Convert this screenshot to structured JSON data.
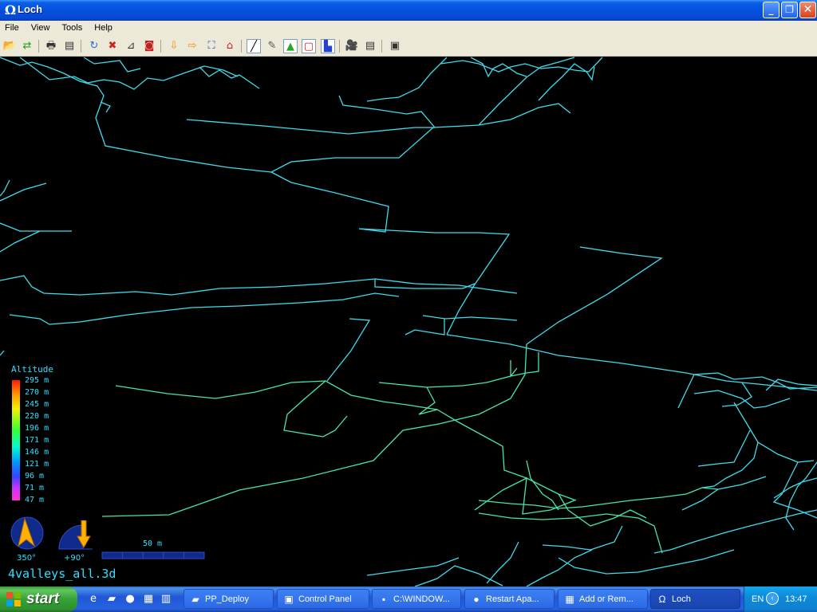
{
  "window": {
    "title": "Loch",
    "app_icon": "omega-icon",
    "controls": {
      "minimize": "_",
      "maximize": "❐",
      "close": "✕"
    }
  },
  "menu": {
    "items": [
      "File",
      "View",
      "Tools",
      "Help"
    ]
  },
  "toolbar": {
    "buttons": [
      {
        "icon": "open-folder-icon",
        "glyph": "📂",
        "color": "#d9a520"
      },
      {
        "icon": "reload-icon",
        "glyph": "⇄",
        "color": "#22a022"
      },
      {
        "icon": "print-icon",
        "glyph": "🖶",
        "color": "#333333"
      },
      {
        "icon": "export-icon",
        "glyph": "▤",
        "color": "#333333"
      },
      {
        "icon": "rotate-icon",
        "glyph": "↻",
        "color": "#2a6fe0"
      },
      {
        "icon": "rotation-off-icon",
        "glyph": "✖",
        "color": "#cc2222"
      },
      {
        "icon": "camera-angle-icon",
        "glyph": "⊿",
        "color": "#333333"
      },
      {
        "icon": "stereo-glasses-icon",
        "glyph": "◙",
        "color": "#c02020"
      },
      {
        "icon": "plan-view-icon",
        "glyph": "⇩",
        "color": "#ff8800"
      },
      {
        "icon": "elevation-view-icon",
        "glyph": "⇨",
        "color": "#ff8800"
      },
      {
        "icon": "zoom-all-icon",
        "glyph": "⛶",
        "color": "#2244cc"
      },
      {
        "icon": "home-view-icon",
        "glyph": "⌂",
        "color": "#cc2222"
      },
      {
        "icon": "centerline-icon",
        "glyph": "╱",
        "color": "#000000"
      },
      {
        "icon": "walls-icon",
        "glyph": "✎",
        "color": "#555555"
      },
      {
        "icon": "surface-icon",
        "glyph": "▲",
        "color": "#22aa22"
      },
      {
        "icon": "bounding-box-icon",
        "glyph": "▢",
        "color": "#cc2222"
      },
      {
        "icon": "altitude-legend-icon",
        "glyph": "▙",
        "color": "#2244cc"
      },
      {
        "icon": "film-camera-icon",
        "glyph": "🎥",
        "color": "#333333"
      },
      {
        "icon": "info-panel-icon",
        "glyph": "▤",
        "color": "#333333"
      },
      {
        "icon": "fullscreen-icon",
        "glyph": "▣",
        "color": "#333333"
      }
    ]
  },
  "legend": {
    "title": "Altitude",
    "labels": [
      "295 m",
      "270 m",
      "245 m",
      "220 m",
      "196 m",
      "171 m",
      "146 m",
      "121 m",
      "96 m",
      "71 m",
      "47 m"
    ]
  },
  "compass": {
    "heading": "350°"
  },
  "inclinometer": {
    "tilt": "+90°"
  },
  "scale": {
    "label": "50 m"
  },
  "file": {
    "name": "4valleys_all.3d"
  },
  "colors": {
    "centerline": "#3fdcec",
    "centerline_low": "#46e8a8",
    "hud_text": "#2de0ff"
  },
  "taskbar": {
    "start_label": "start",
    "quick_launch": [
      {
        "icon": "internet-explorer-icon",
        "glyph": "e"
      },
      {
        "icon": "explorer-folder-icon",
        "glyph": "▰"
      },
      {
        "icon": "firefox-icon",
        "glyph": "●"
      },
      {
        "icon": "media-icon",
        "glyph": "▦"
      },
      {
        "icon": "notepad-icon",
        "glyph": "▥"
      }
    ],
    "tasks": [
      {
        "label": "PP_Deploy",
        "icon": "folder-icon",
        "active": false
      },
      {
        "label": "Control Panel",
        "icon": "control-panel-icon",
        "active": false
      },
      {
        "label": "C:\\WINDOW...",
        "icon": "command-prompt-icon",
        "active": false
      },
      {
        "label": "Restart Apa...",
        "icon": "firefox-icon",
        "active": false
      },
      {
        "label": "Add or Rem...",
        "icon": "add-remove-programs-icon",
        "active": false
      },
      {
        "label": "Loch",
        "icon": "omega-icon",
        "active": true
      }
    ],
    "tray": {
      "language": "EN",
      "clock": "13:47"
    }
  }
}
